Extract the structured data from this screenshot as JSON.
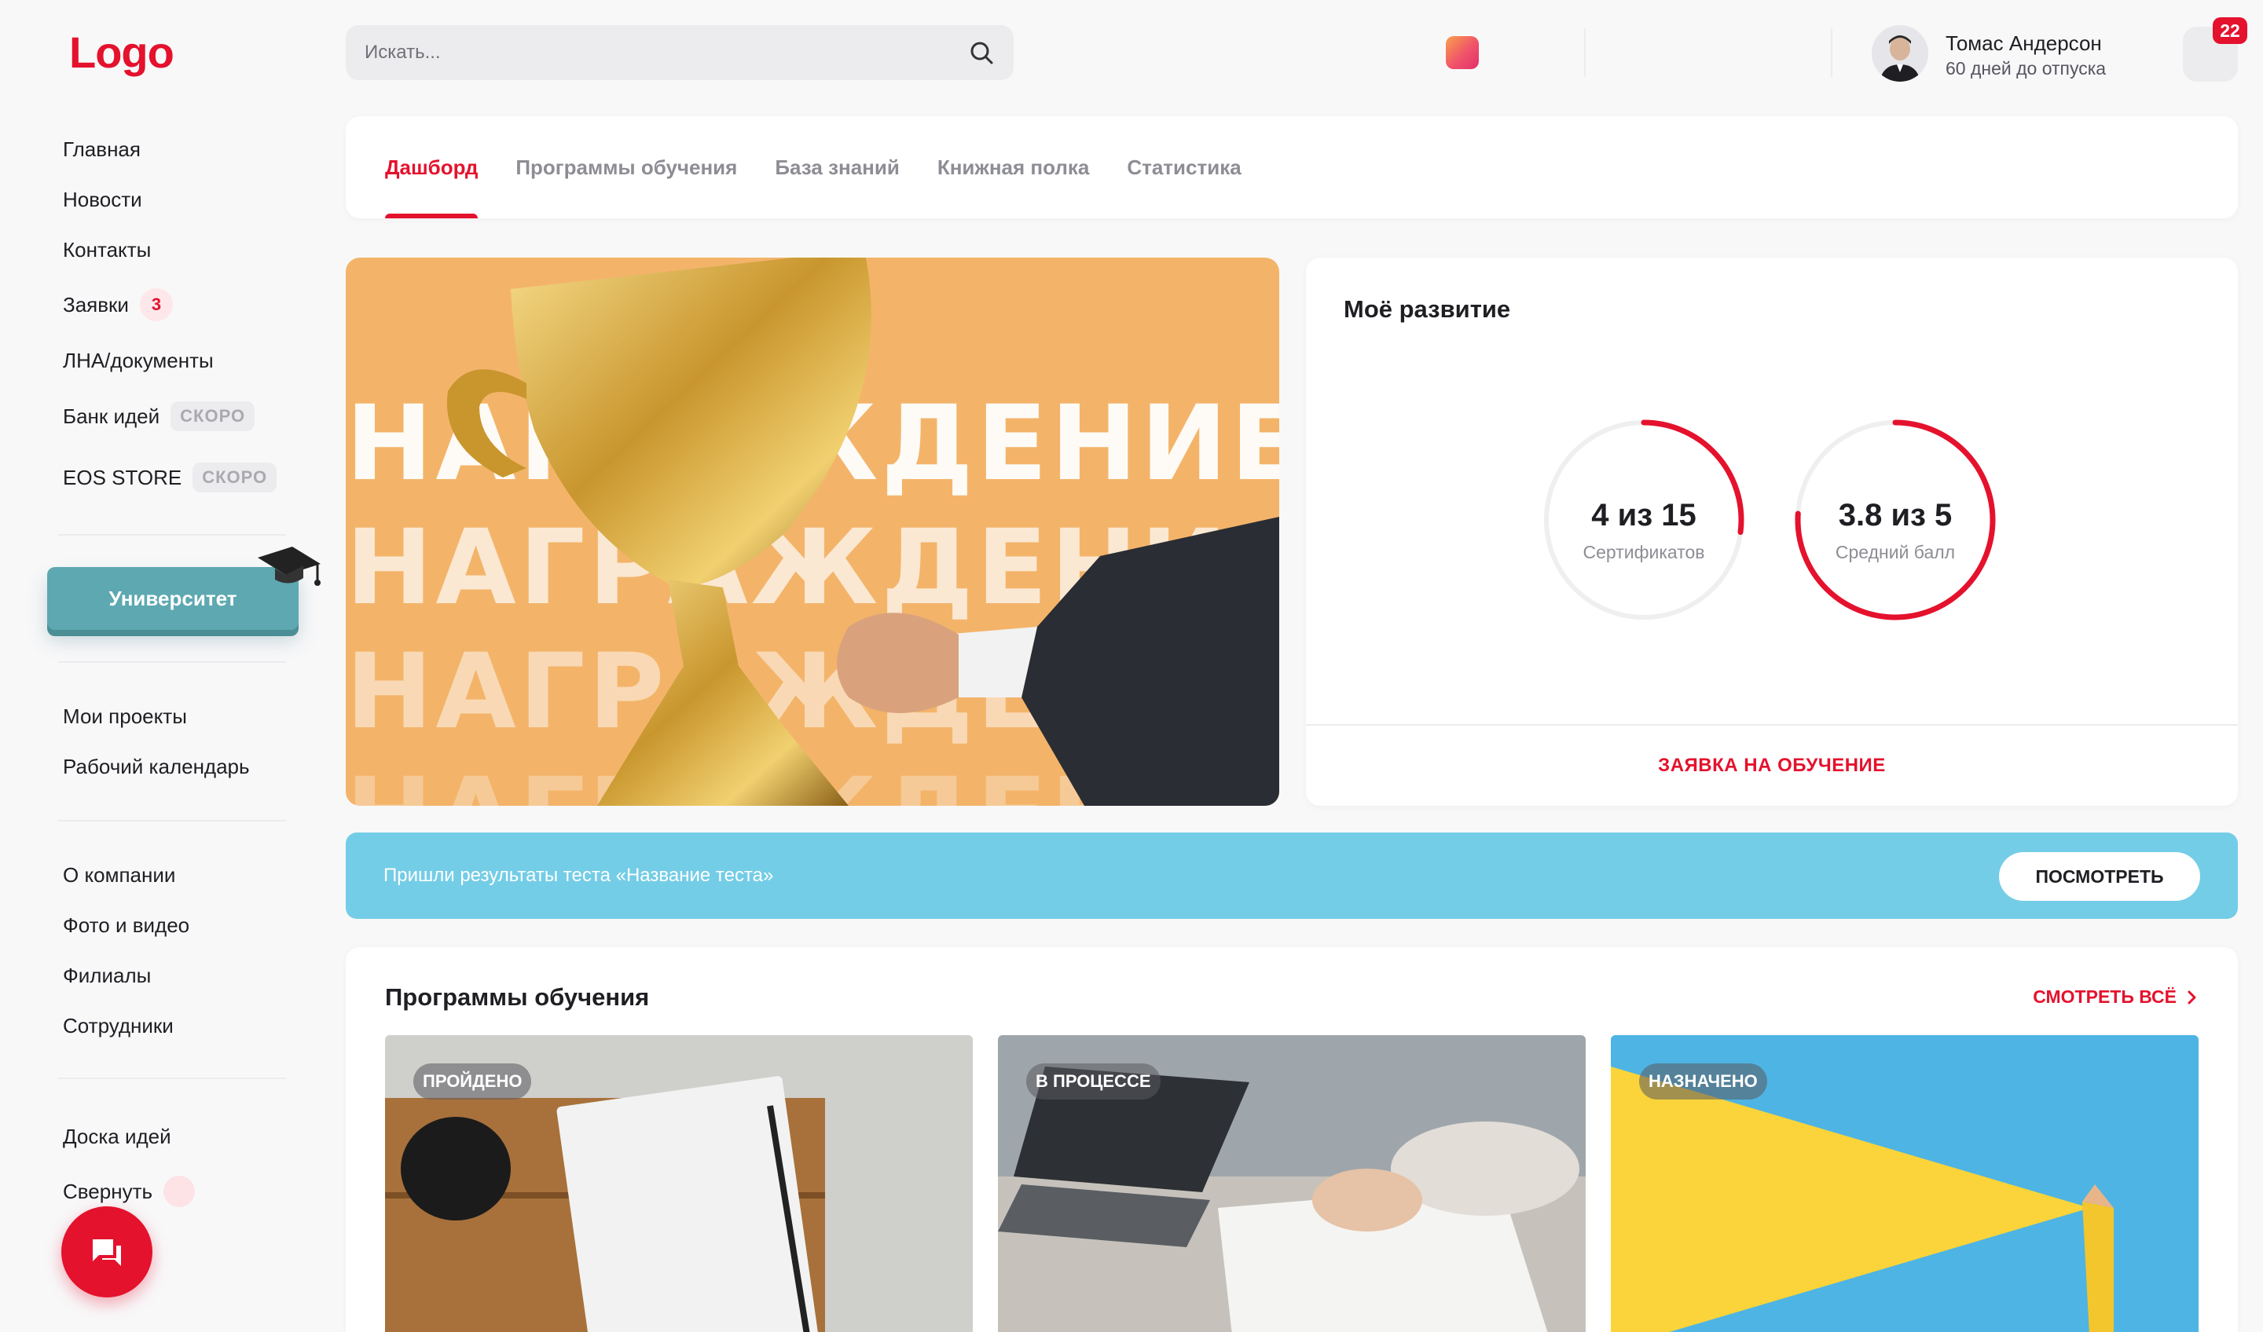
{
  "brand": {
    "logo": "Logo",
    "accent": "#e4122d",
    "university_color": "#5da8b1",
    "banner_color": "#74cde6"
  },
  "sidebar": {
    "group1": [
      {
        "label": "Главная"
      },
      {
        "label": "Новости"
      },
      {
        "label": "Контакты"
      },
      {
        "label": "Заявки",
        "count": "3"
      },
      {
        "label": "ЛНА/документы"
      },
      {
        "label": "Банк идей",
        "soon": "СКОРО"
      },
      {
        "label": "EOS STORE",
        "soon": "СКОРО"
      }
    ],
    "university_button": "Университет",
    "group2": [
      {
        "label": "Мои проекты"
      },
      {
        "label": "Рабочий календарь"
      }
    ],
    "group3": [
      {
        "label": "О компании"
      },
      {
        "label": "Фото и видео"
      },
      {
        "label": "Филиалы"
      },
      {
        "label": "Сотрудники"
      }
    ],
    "group4": [
      {
        "label": "Доска идей"
      },
      {
        "label": "Свернуть"
      }
    ]
  },
  "header": {
    "search_placeholder": "Искать...",
    "user": {
      "name": "Томас Андерсон",
      "subtitle": "60 дней до отпуска"
    },
    "notifications_count": "22"
  },
  "tabs": [
    {
      "label": "Дашборд",
      "active": true
    },
    {
      "label": "Программы обучения"
    },
    {
      "label": "База знаний"
    },
    {
      "label": "Книжная полка"
    },
    {
      "label": "Статистика"
    }
  ],
  "hero": {
    "words": [
      "НАГРАЖДЕНИЕ",
      "НАГРАЖДЕНИЕ",
      "НАГРАЖДЕНИЕ",
      "НАГРАЖДЕНИЕ"
    ]
  },
  "development": {
    "title": "Моё развитие",
    "certificates": {
      "value": "4 из 15",
      "label": "Сертификатов",
      "fraction": 0.27
    },
    "score": {
      "value": "3.8 из 5",
      "label": "Средний балл",
      "fraction": 0.76
    },
    "request_link": "ЗАЯВКА НА ОБУЧЕНИЕ"
  },
  "banner": {
    "text": "Пришли результаты теста «Название теста»",
    "button": "ПОСМОТРЕТЬ"
  },
  "programs": {
    "title": "Программы обучения",
    "see_all": "СМОТРЕТЬ ВСЁ",
    "cards": [
      {
        "status": "ПРОЙДЕНО"
      },
      {
        "status": "В ПРОЦЕССЕ"
      },
      {
        "status": "НАЗНАЧЕНО"
      }
    ]
  }
}
